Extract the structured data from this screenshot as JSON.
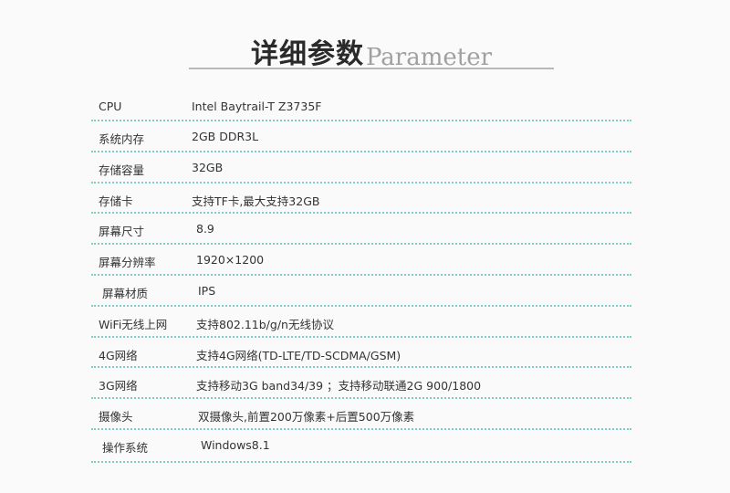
{
  "header": {
    "title_cn": "详细参数",
    "title_en": "Parameter"
  },
  "rows": [
    {
      "label": "CPU",
      "value": "Intel Baytrail-T Z3735F"
    },
    {
      "label": "系统内存",
      "value": "2GB DDR3L"
    },
    {
      "label": "存储容量",
      "value": "32GB"
    },
    {
      "label": "存储卡",
      "value": "支持TF卡,最大支持32GB"
    },
    {
      "label": "屏幕尺寸",
      "value": "8.9"
    },
    {
      "label": "屏幕分辨率",
      "value": "1920×1200"
    },
    {
      "label": "屏幕材质",
      "value": "IPS"
    },
    {
      "label": "WiFi无线上网",
      "value": "支持802.11b/g/n无线协议"
    },
    {
      "label": "4G网络",
      "value": "支持4G网络(TD-LTE/TD-SCDMA/GSM)"
    },
    {
      "label": "3G网络",
      "value": "支持移动3G band34/39 ；支持移动联通2G 900/1800"
    },
    {
      "label": "摄像头",
      "value": "双摄像头,前置200万像素+后置500万像素"
    },
    {
      "label": "操作系统",
      "value": "Windows8.1"
    }
  ]
}
